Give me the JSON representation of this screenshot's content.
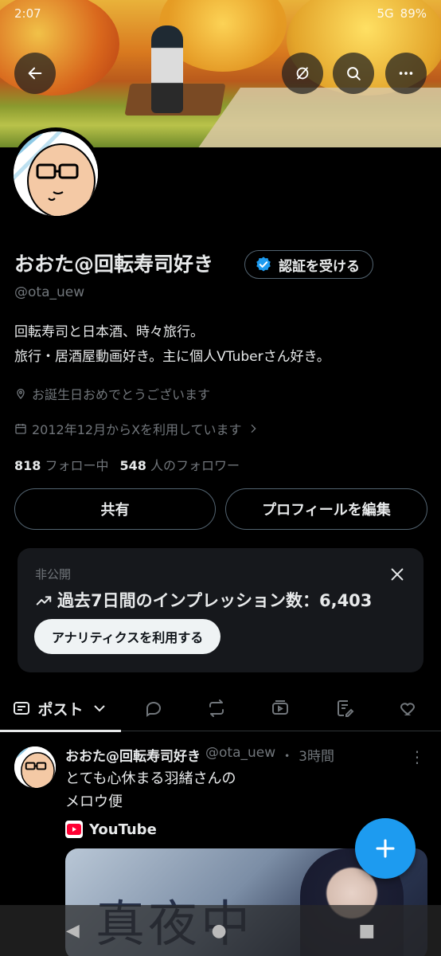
{
  "status_bar": {
    "time": "2:07",
    "network": "5G",
    "battery": "89%"
  },
  "profile": {
    "display_name": "おおた@回転寿司好き",
    "verify_button": "認証を受ける",
    "handle": "@ota_uew",
    "bio_lines": [
      "回転寿司と日本酒、時々旅行。",
      "旅行・居酒屋動画好き。主に個人VTuberさん好き。"
    ],
    "location": "お誕生日おめでとうございます",
    "joined": "2012年12月からXを利用しています",
    "following_count": "818",
    "following_label": "フォロー中",
    "followers_count": "548",
    "followers_label": "人のフォロワー"
  },
  "actions": {
    "share": "共有",
    "edit_profile": "プロフィールを編集"
  },
  "analytics_card": {
    "label": "非公開",
    "impressions": "過去7日間のインプレッション数：6,403",
    "button": "アナリティクスを利用する"
  },
  "tabs": {
    "active_label": "ポスト"
  },
  "post": {
    "name": "おおた@回転寿司好き",
    "handle": "@ota_uew",
    "separator": "・",
    "time": "3時間",
    "text_lines": [
      "とても心休まる羽緒さんの",
      "メロウ便"
    ],
    "source": "YouTube",
    "thumb_title": "真夜中"
  },
  "colors": {
    "accent": "#1d9bf0",
    "background": "#000000",
    "muted": "#71767b",
    "text": "#e7e9ea"
  }
}
